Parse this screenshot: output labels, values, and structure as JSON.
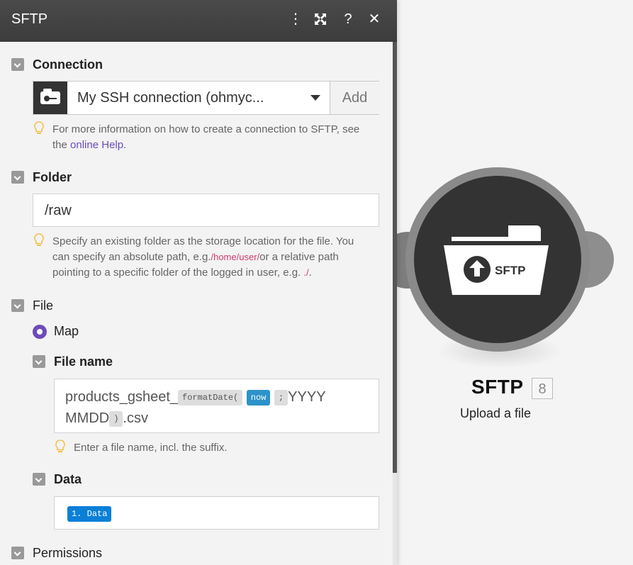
{
  "panel": {
    "title": "SFTP",
    "buttons": {
      "menu": "⋮",
      "expand": "⤢",
      "help": "?",
      "close": "✕"
    }
  },
  "connection": {
    "label": "Connection",
    "value": "My SSH connection (ohmyc...",
    "add_label": "Add",
    "hint_prefix": "For more information on how to create a connection to SFTP, see",
    "hint_the": "the",
    "hint_link": "online Help",
    "hint_suffix": "."
  },
  "folder": {
    "label": "Folder",
    "value": "/raw",
    "hint_1": "Specify an existing folder as the storage location for the file. You",
    "hint_2": "can specify an absolute path, e.g.",
    "hint_code1": "/home/user/",
    "hint_3": "or a relative path",
    "hint_4": "pointing to a specific folder of the logged in user, e.g.",
    "hint_code2": "./",
    "hint_5": "."
  },
  "file": {
    "label": "File",
    "map_label": "Map",
    "filename": {
      "label": "File name",
      "prefix": "products_gsheet_",
      "fn": "formatDate(",
      "now": "now",
      "sep": ";",
      "fmt1": "YYYY",
      "fmt2": "MMDD",
      "close": ")",
      "suffix": ".csv",
      "hint": "Enter a file name, incl. the suffix."
    },
    "data": {
      "label": "Data",
      "pill": "1. Data"
    }
  },
  "permissions": {
    "label": "Permissions"
  },
  "node": {
    "title": "SFTP",
    "badge": "8",
    "subtitle": "Upload a file",
    "icon_text": "SFTP",
    "icon": "upload-folder-icon"
  },
  "colors": {
    "accent_purple": "#6c4bb8",
    "pill_blue": "#2d93c9",
    "data_blue": "#0a7fd8",
    "titlebar": "#444444",
    "node_dark": "#333333"
  }
}
